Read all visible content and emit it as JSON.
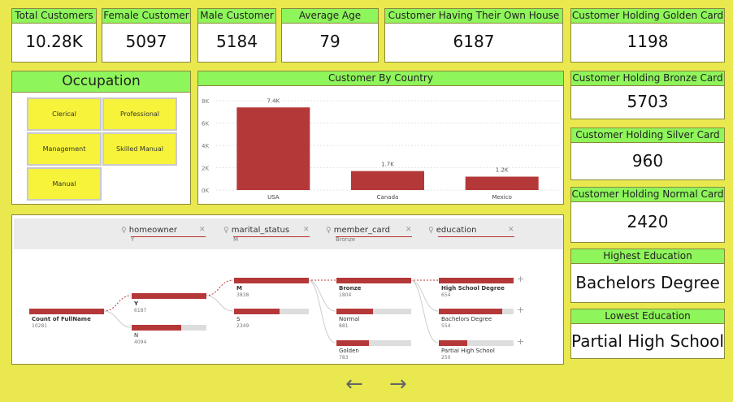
{
  "kpis": {
    "total_customers": {
      "label": "Total Customers",
      "value": "10.28K"
    },
    "female": {
      "label": "Female Customer",
      "value": "5097"
    },
    "male": {
      "label": "Male Customer",
      "value": "5184"
    },
    "avg_age": {
      "label": "Average Age",
      "value": "79"
    },
    "own_house": {
      "label": "Customer Having Their Own House",
      "value": "6187"
    },
    "golden": {
      "label": "Customer Holding Golden Card",
      "value": "1198"
    },
    "bronze": {
      "label": "Customer Holding Bronze Card",
      "value": "5703"
    },
    "silver": {
      "label": "Customer Holding Silver Card",
      "value": "960"
    },
    "normal": {
      "label": "Customer Holding Normal Card",
      "value": "2420"
    },
    "highest_edu": {
      "label": "Highest Education",
      "value": "Bachelors Degree"
    },
    "lowest_edu": {
      "label": "Lowest Education",
      "value": "Partial High School"
    }
  },
  "occupation": {
    "title": "Occupation",
    "items": [
      "Clerical",
      "Professional",
      "Management",
      "Skilled Manual",
      "Manual"
    ]
  },
  "country_chart": {
    "title": "Customer By Country"
  },
  "chart_data": {
    "type": "bar",
    "title": "Customer By Country",
    "categories": [
      "USA",
      "Canada",
      "Mexico"
    ],
    "values": [
      7400,
      1700,
      1200
    ],
    "data_labels": [
      "7.4K",
      "1.7K",
      "1.2K"
    ],
    "yticks": [
      "0K",
      "2K",
      "4K",
      "6K",
      "8K"
    ],
    "ylim": [
      0,
      8000
    ],
    "color": "#b53838"
  },
  "decomp": {
    "crumbs": [
      {
        "label": "homeowner",
        "value": "Y"
      },
      {
        "label": "marital_status",
        "value": "M"
      },
      {
        "label": "member_card",
        "value": "Bronze"
      },
      {
        "label": "education",
        "value": ""
      }
    ],
    "root": {
      "label": "Count of FullName",
      "value": "10281"
    },
    "homeowner": [
      {
        "label": "Y",
        "value": "6187",
        "fill": 1.0
      },
      {
        "label": "N",
        "value": "4094",
        "fill": 0.66
      }
    ],
    "marital": [
      {
        "label": "M",
        "value": "3838",
        "fill": 1.0
      },
      {
        "label": "S",
        "value": "2349",
        "fill": 0.61
      }
    ],
    "member_card": [
      {
        "label": "Bronze",
        "value": "1804",
        "fill": 1.0
      },
      {
        "label": "Normal",
        "value": "881",
        "fill": 0.49
      },
      {
        "label": "Golden",
        "value": "783",
        "fill": 0.43
      }
    ],
    "education": [
      {
        "label": "High School Degree",
        "value": "654",
        "fill": 1.0
      },
      {
        "label": "Bachelors Degree",
        "value": "554",
        "fill": 0.85
      },
      {
        "label": "Partial High School",
        "value": "250",
        "fill": 0.38
      }
    ]
  },
  "nav": {
    "prev": "←",
    "next": "→"
  }
}
